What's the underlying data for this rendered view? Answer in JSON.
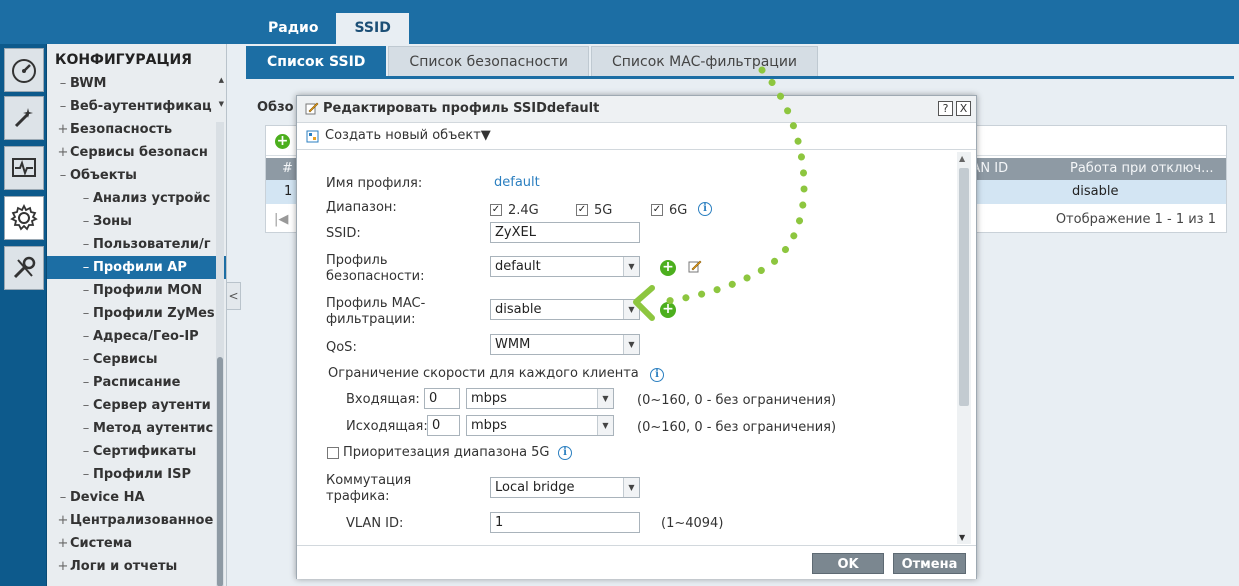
{
  "top_tabs": [
    {
      "label": "Радио"
    },
    {
      "label": "SSID"
    }
  ],
  "sidebar": {
    "header": "КОНФИГУРАЦИЯ",
    "items": [
      {
        "label": "BWM",
        "expander": "–"
      },
      {
        "label": "Веб-аутентификац",
        "expander": "–"
      },
      {
        "label": "Безопасность",
        "expander": "+"
      },
      {
        "label": "Сервисы безопасн",
        "expander": "+"
      },
      {
        "label": "Объекты",
        "expander": "–"
      },
      {
        "label": "Анализ устройс",
        "expander": "–"
      },
      {
        "label": "Зоны",
        "expander": "–"
      },
      {
        "label": "Пользователи/г",
        "expander": "–"
      },
      {
        "label": "Профили AP",
        "expander": "–"
      },
      {
        "label": "Профили MON",
        "expander": "–"
      },
      {
        "label": "Профили ZyMes",
        "expander": "–"
      },
      {
        "label": "Адреса/Гео-IP",
        "expander": "–"
      },
      {
        "label": "Сервисы",
        "expander": "–"
      },
      {
        "label": "Расписание",
        "expander": "–"
      },
      {
        "label": "Сервер аутенти",
        "expander": "–"
      },
      {
        "label": "Метод аутентис",
        "expander": "–"
      },
      {
        "label": "Сертификаты",
        "expander": "–"
      },
      {
        "label": "Профили ISP",
        "expander": "–"
      },
      {
        "label": "Device HA",
        "expander": "–"
      },
      {
        "label": "Централизованное",
        "expander": "+"
      },
      {
        "label": "Система",
        "expander": "+"
      },
      {
        "label": "Логи и отчеты",
        "expander": "+"
      }
    ]
  },
  "subtabs": [
    {
      "label": "Список SSID"
    },
    {
      "label": "Список безопасности"
    },
    {
      "label": "Список MAC-фильтрации"
    }
  ],
  "background": {
    "overview_title": "Обзо",
    "add_text": "+",
    "columns": [
      "#",
      "LAN ID",
      "Работа при отключ..."
    ],
    "row": {
      "num": "1",
      "action": "disable"
    },
    "footer": "Отображение 1 - 1 из 1"
  },
  "modal": {
    "title": "Редактировать профиль SSIDdefault",
    "help_btn": "?",
    "close_btn": "X",
    "create_new": "Создать новый объект▼",
    "fields": {
      "profile_name_label": "Имя профиля:",
      "profile_name_value": "default",
      "band_label": "Диапазон:",
      "band_options": [
        {
          "label": "2.4G",
          "checked": true
        },
        {
          "label": "5G",
          "checked": true
        },
        {
          "label": "6G",
          "checked": true
        }
      ],
      "ssid_label": "SSID:",
      "ssid_value": "ZyXEL",
      "security_label": "Профиль\nбезопасности:",
      "security_value": "default",
      "mac_label": "Профиль MAC-\nфильтрации:",
      "mac_value": "disable",
      "qos_label": "QoS:",
      "qos_value": "WMM",
      "rate_limit_label": "Ограничение скорости для каждого клиента",
      "incoming_label": "Входящая:",
      "incoming_value": "0",
      "incoming_unit": "mbps",
      "incoming_hint": "(0~160, 0 - без ограничения)",
      "outgoing_label": "Исходящая:",
      "outgoing_value": "0",
      "outgoing_unit": "mbps",
      "outgoing_hint": "(0~160, 0 - без ограничения)",
      "band_priority_label": "Приоритезация диапазона 5G",
      "switching_label": "Коммутация\nтрафика:",
      "switching_value": "Local bridge",
      "vlan_label": "VLAN ID:",
      "vlan_value": "1",
      "vlan_hint": "(1~4094)"
    },
    "ok": "OK",
    "cancel": "Отмена"
  },
  "colors": {
    "brand_blue": "#1c6ea4",
    "add_green": "#4caf1e",
    "annotation_green": "#8dc63f",
    "link_blue": "#2b7fc0"
  },
  "icons": [
    "dashboard-icon",
    "wizard-wand-icon",
    "monitor-pulse-icon",
    "gear-icon",
    "tools-icon",
    "pencil-icon",
    "object-icon",
    "plus-icon",
    "edit-icon",
    "info-icon",
    "chevron-down-icon",
    "close-icon",
    "help-icon"
  ]
}
